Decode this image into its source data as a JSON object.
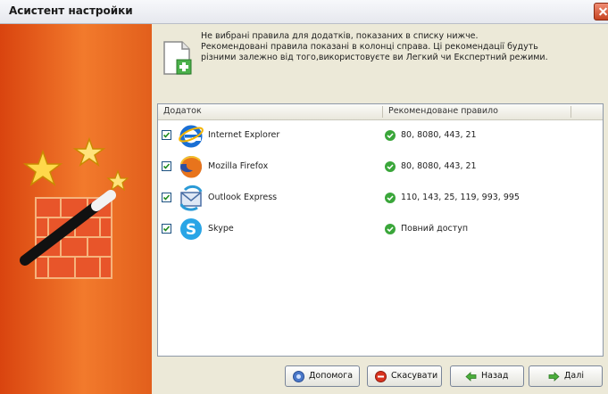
{
  "window": {
    "title": "Асистент настройки"
  },
  "info": {
    "lines": [
      "Не вибрані правила для додатків, показаних в списку нижче.",
      "Рекомендовані правила показані в колонці справа. Ці рекомендації будуть",
      "різними залежно від того,використовуєте ви Легкий чи Експертний режими."
    ]
  },
  "list": {
    "columns": {
      "app": "Додаток",
      "rule": "Рекомендоване правило"
    },
    "rows": [
      {
        "app": "Internet Explorer",
        "rule": "80, 8080, 443, 21",
        "icon": "internet-explorer-icon",
        "checked": true
      },
      {
        "app": "Mozilla Firefox",
        "rule": "80, 8080, 443, 21",
        "icon": "firefox-icon",
        "checked": true
      },
      {
        "app": "Outlook Express",
        "rule": "110, 143, 25, 119, 993, 995",
        "icon": "outlook-express-icon",
        "checked": true
      },
      {
        "app": "Skype",
        "rule": "Повний доступ",
        "icon": "skype-icon",
        "checked": true
      }
    ]
  },
  "buttons": {
    "help": "Допомога",
    "cancel": "Скасувати",
    "back": "Назад",
    "next": "Далі"
  },
  "colors": {
    "accent": "#e8631f",
    "ok": "#3aa63a",
    "checkbox": "#1c5180"
  }
}
